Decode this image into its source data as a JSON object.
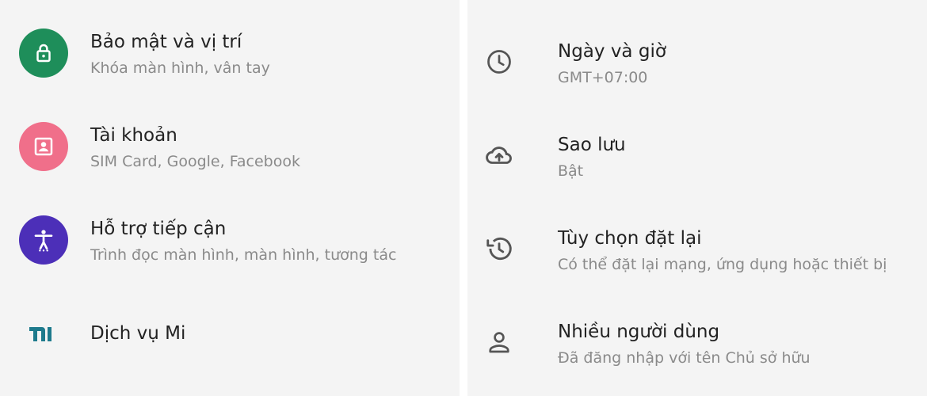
{
  "left": {
    "items": [
      {
        "title": "Bảo mật và vị trí",
        "subtitle": "Khóa màn hình, vân tay",
        "icon": "lock-icon",
        "color": "#1e8e5a"
      },
      {
        "title": "Tài khoản",
        "subtitle": "SIM Card, Google, Facebook",
        "icon": "account-box-icon",
        "color": "#f06f8a"
      },
      {
        "title": "Hỗ trợ tiếp cận",
        "subtitle": "Trình đọc màn hình, màn hình, tương tác",
        "icon": "accessibility-icon",
        "color": "#4c2fb8"
      },
      {
        "title": "Dịch vụ Mi",
        "subtitle": "",
        "icon": "mi-logo-icon",
        "color": "#1d7a8c"
      }
    ]
  },
  "right": {
    "items": [
      {
        "title": "Ngày và giờ",
        "subtitle": "GMT+07:00",
        "icon": "clock-icon"
      },
      {
        "title": "Sao lưu",
        "subtitle": "Bật",
        "icon": "cloud-upload-icon"
      },
      {
        "title": "Tùy chọn đặt lại",
        "subtitle": "Có thể đặt lại mạng, ứng dụng hoặc thiết bị",
        "icon": "history-icon"
      },
      {
        "title": "Nhiều người dùng",
        "subtitle": "Đã đăng nhập với tên Chủ sở hữu",
        "icon": "person-icon"
      }
    ]
  }
}
